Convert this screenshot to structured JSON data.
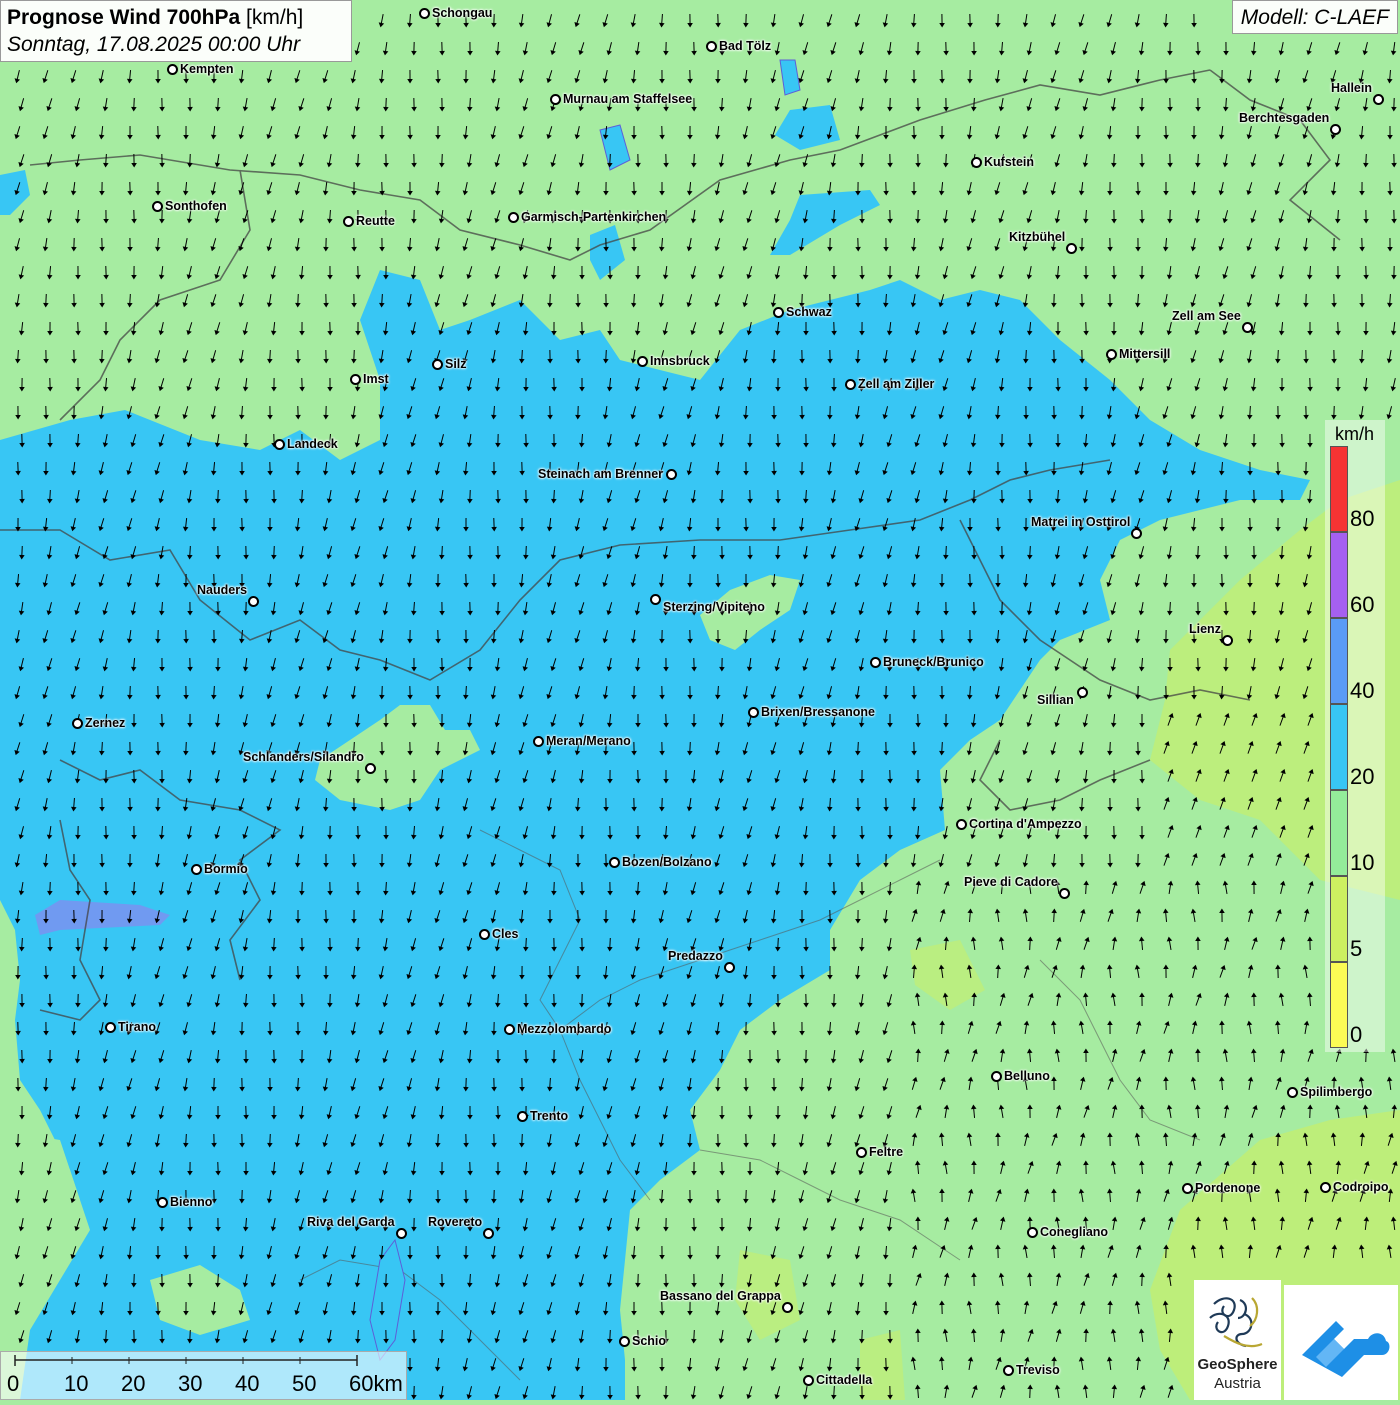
{
  "header": {
    "title": "Prognose Wind 700hPa",
    "unit": "[km/h]",
    "datetime": "Sonntag, 17.08.2025 00:00 Uhr"
  },
  "model": {
    "label": "Modell: C-LAEF"
  },
  "legend": {
    "unit": "km/h",
    "ticks": [
      "80",
      "60",
      "40",
      "20",
      "10",
      "5",
      "0"
    ],
    "colors": [
      "#f53333",
      "#a560f0",
      "#5a9bf5",
      "#38c6f4",
      "#94ec9a",
      "#cdf061",
      "#fbfb55"
    ]
  },
  "scale_bar": {
    "labels": [
      "0",
      "10",
      "20",
      "30",
      "40",
      "50",
      "60km"
    ]
  },
  "cities": [
    {
      "name": "Schongau"
    },
    {
      "name": "Bad Tölz"
    },
    {
      "name": "Kempten"
    },
    {
      "name": "Murnau am Staffelsee"
    },
    {
      "name": "Hallein"
    },
    {
      "name": "Berchtesgaden"
    },
    {
      "name": "Kufstein"
    },
    {
      "name": "Sonthofen"
    },
    {
      "name": "Reutte"
    },
    {
      "name": "Garmisch-Partenkirchen"
    },
    {
      "name": "Kitzbühel"
    },
    {
      "name": "Schwaz"
    },
    {
      "name": "Zell am See"
    },
    {
      "name": "Mittersill"
    },
    {
      "name": "Innsbruck"
    },
    {
      "name": "Silz"
    },
    {
      "name": "Imst"
    },
    {
      "name": "Zell am Ziller"
    },
    {
      "name": "Landeck"
    },
    {
      "name": "Steinach am Brenner"
    },
    {
      "name": "Matrei in Osttirol"
    },
    {
      "name": "Nauders"
    },
    {
      "name": "Sterzing/Vipiteno"
    },
    {
      "name": "Lienz"
    },
    {
      "name": "Bruneck/Brunico"
    },
    {
      "name": "Sillian"
    },
    {
      "name": "Zernez"
    },
    {
      "name": "Brixen/Bressanone"
    },
    {
      "name": "Meran/Merano"
    },
    {
      "name": "Schlanders/Silandro"
    },
    {
      "name": "Cortina d'Ampezzo"
    },
    {
      "name": "Bozen/Bolzano"
    },
    {
      "name": "Bormio"
    },
    {
      "name": "Pieve di Cadore"
    },
    {
      "name": "Cles"
    },
    {
      "name": "Predazzo"
    },
    {
      "name": "Tirano"
    },
    {
      "name": "Mezzolombardo"
    },
    {
      "name": "Belluno"
    },
    {
      "name": "Spilimbergo"
    },
    {
      "name": "Trento"
    },
    {
      "name": "Feltre"
    },
    {
      "name": "Bienno"
    },
    {
      "name": "Pordenone"
    },
    {
      "name": "Codroipo"
    },
    {
      "name": "Riva del Garda"
    },
    {
      "name": "Rovereto"
    },
    {
      "name": "Conegliano"
    },
    {
      "name": "Bassano del Grappa"
    },
    {
      "name": "Schio"
    },
    {
      "name": "Treviso"
    },
    {
      "name": "Cittadella"
    }
  ],
  "logos": {
    "geosphere_line1": "GeoSphere",
    "geosphere_line2": "Austria"
  }
}
